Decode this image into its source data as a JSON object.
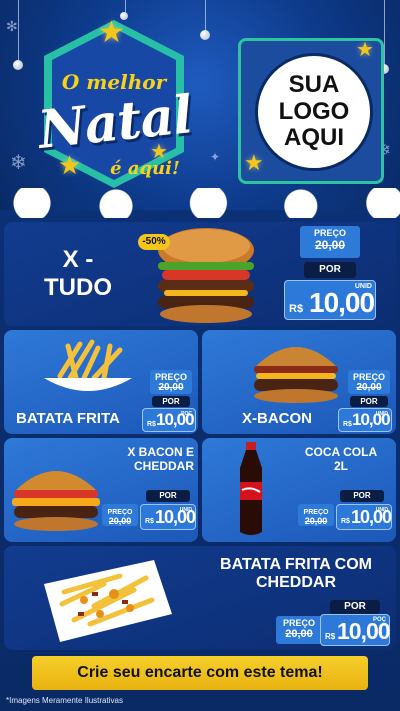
{
  "header": {
    "badge_top": "O melhor",
    "badge_main": "Natal",
    "badge_sub": "é aqui!",
    "logo_lines": [
      "SUA",
      "LOGO",
      "AQUI"
    ]
  },
  "featured": {
    "name_line1": "X -",
    "name_line2": "TUDO",
    "discount": "-50%",
    "preco_label": "PREÇO",
    "old_price": "20,00",
    "por_label": "POR",
    "currency": "R$",
    "price": "10,00",
    "unit": "UNID"
  },
  "items": [
    {
      "name": "BATATA FRITA",
      "preco_label": "PREÇO",
      "old_price": "20,00",
      "por_label": "POR",
      "currency": "R$",
      "price": "10,00",
      "unit": "POÇ"
    },
    {
      "name": "X-BACON",
      "preco_label": "PREÇO",
      "old_price": "20,00",
      "por_label": "POR",
      "currency": "R$",
      "price": "10,00",
      "unit": "UNID"
    },
    {
      "name_line1": "X BACON E",
      "name_line2": "CHEDDAR",
      "preco_label": "PREÇO",
      "old_price": "20,00",
      "por_label": "POR",
      "currency": "R$",
      "price": "10,00",
      "unit": "UNID"
    },
    {
      "name_line1": "COCA COLA",
      "name_line2": "2L",
      "preco_label": "PREÇO",
      "old_price": "20,00",
      "por_label": "POR",
      "currency": "R$",
      "price": "10,00",
      "unit": "UNID"
    }
  ],
  "bottom_item": {
    "name_line1": "BATATA FRITA COM",
    "name_line2": "CHEDDAR",
    "preco_label": "PREÇO",
    "old_price": "20,00",
    "por_label": "POR",
    "currency": "R$",
    "price": "10,00",
    "unit": "POÇ"
  },
  "cta": "Crie seu encarte com este tema!",
  "footnote": "*Imagens Meramente Ilustrativas"
}
